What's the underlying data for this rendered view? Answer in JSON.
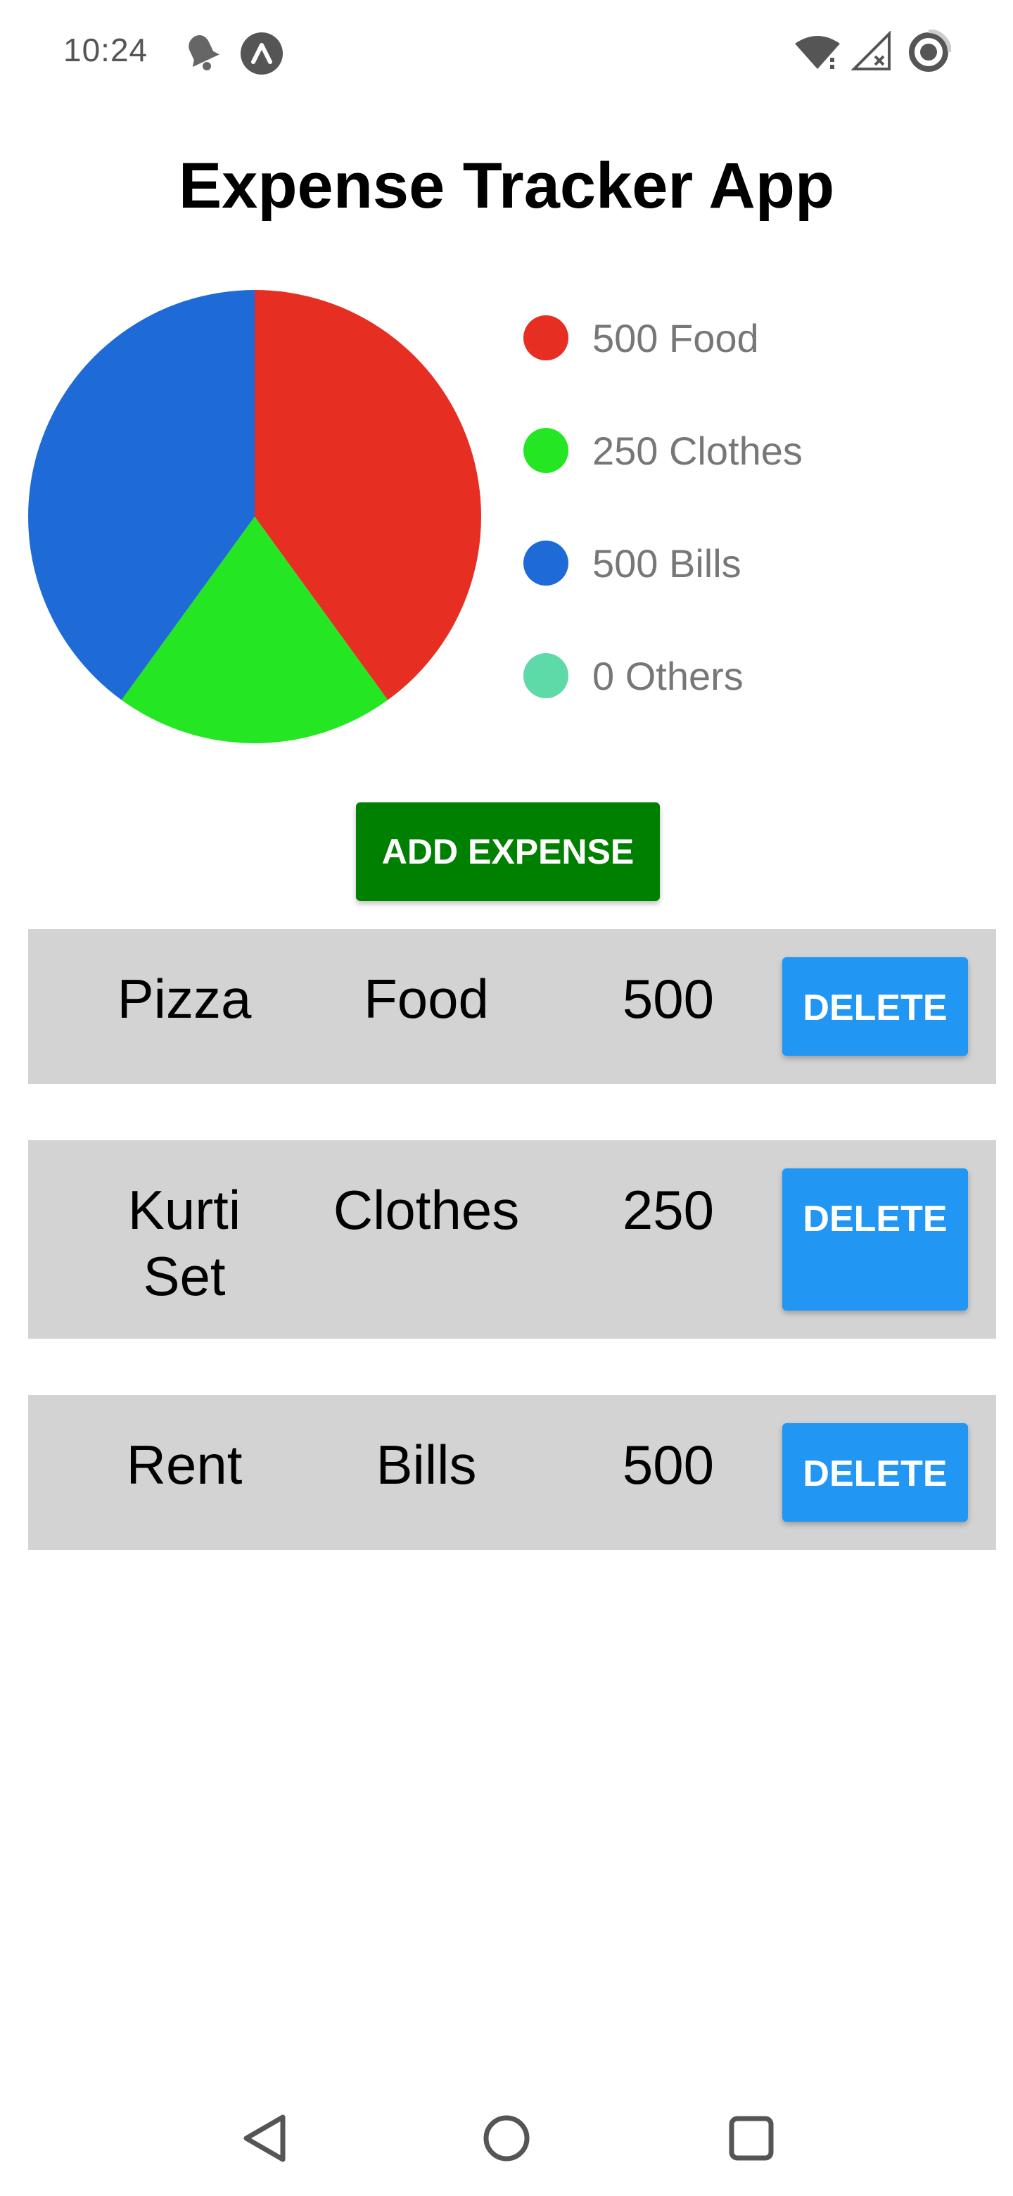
{
  "status_bar": {
    "time": "10:24",
    "icons_left": [
      "notification-bell-icon",
      "expo-app-icon"
    ],
    "icons_right": [
      "wifi-icon",
      "no-signal-icon",
      "battery-saver-icon"
    ]
  },
  "app": {
    "title": "Expense Tracker App"
  },
  "chart_data": {
    "type": "pie",
    "slices": [
      {
        "label": "Food",
        "value": 500,
        "color": "#e62e22"
      },
      {
        "label": "Clothes",
        "value": 250,
        "color": "#25e622"
      },
      {
        "label": "Bills",
        "value": 500,
        "color": "#1e6ad6"
      },
      {
        "label": "Others",
        "value": 0,
        "color": "#5ed9a8"
      }
    ]
  },
  "legend": [
    {
      "text": "500 Food",
      "color": "#e62e22"
    },
    {
      "text": "250 Clothes",
      "color": "#25e622"
    },
    {
      "text": "500 Bills",
      "color": "#1e6ad6"
    },
    {
      "text": "0 Others",
      "color": "#5ed9a8"
    }
  ],
  "add_button": {
    "label": "ADD EXPENSE",
    "color": "#008000"
  },
  "expenses": [
    {
      "name": "Pizza",
      "category": "Food",
      "amount": "500",
      "delete_label": "DELETE"
    },
    {
      "name": "Kurti Set",
      "category": "Clothes",
      "amount": "250",
      "delete_label": "DELETE"
    },
    {
      "name": "Rent",
      "category": "Bills",
      "amount": "500",
      "delete_label": "DELETE"
    }
  ],
  "nav_bar": {
    "buttons": [
      "back-icon",
      "home-icon",
      "recents-icon"
    ]
  }
}
